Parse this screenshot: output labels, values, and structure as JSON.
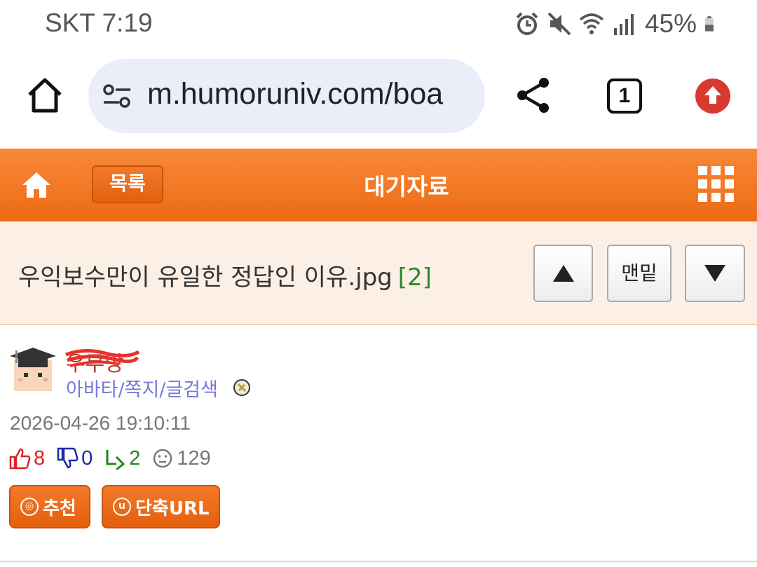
{
  "status_bar": {
    "carrier_time": "SKT 7:19",
    "battery_percent": "45%",
    "icons": [
      "alarm-icon",
      "mute-icon",
      "wifi-icon",
      "signal-icon",
      "battery-icon"
    ]
  },
  "browser": {
    "url": "m.humoruniv.com/boa",
    "tab_count": "1",
    "icons": [
      "home-icon",
      "site-settings-icon",
      "share-icon",
      "tabs-icon",
      "update-icon"
    ]
  },
  "site_header": {
    "list_button": "목록",
    "title": "대기자료",
    "accent_color": "#ee6a12"
  },
  "post": {
    "title": "우익보수만이 유일한 정답인 이유.jpg",
    "comment_count": "[2]",
    "nav": {
      "bottom_label": "맨밑"
    },
    "author": {
      "name": "우무망",
      "links": "아바타/쪽지/글검색"
    },
    "date": "2026-04-26 19:10:11",
    "stats": {
      "up": "8",
      "down": "0",
      "replies": "2",
      "views": "129"
    },
    "buttons": {
      "recommend": "추천",
      "short_url": "단축URL"
    }
  }
}
